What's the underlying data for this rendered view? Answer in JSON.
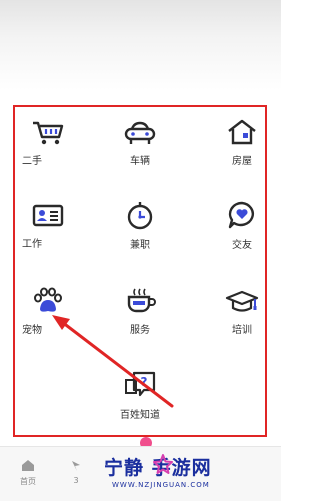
{
  "categories": [
    {
      "label": "二手",
      "icon": "shopping-cart-icon"
    },
    {
      "label": "车辆",
      "icon": "car-icon"
    },
    {
      "label": "房屋",
      "icon": "house-icon"
    },
    {
      "label": "工作",
      "icon": "id-card-icon"
    },
    {
      "label": "兼职",
      "icon": "clock-icon"
    },
    {
      "label": "交友",
      "icon": "heart-bubble-icon"
    },
    {
      "label": "宠物",
      "icon": "paw-icon"
    },
    {
      "label": "服务",
      "icon": "coffee-cup-icon"
    },
    {
      "label": "培训",
      "icon": "graduation-cap-icon"
    },
    {
      "label": "百姓知道",
      "icon": "question-bubble-icon"
    }
  ],
  "bottom_tabs": [
    {
      "label": "首页",
      "icon": "home-icon"
    },
    {
      "label": "3",
      "icon": "tab-icon"
    }
  ],
  "watermark": {
    "title": "宁静  手游网",
    "subtitle": "WWW.NZJINGUAN.COM"
  },
  "colors": {
    "highlight": "#e02525",
    "arrow": "#e02525",
    "icon_stroke": "#2a2a2a",
    "icon_accent": "#3b4bd8",
    "watermark": "#1a2e9e"
  }
}
